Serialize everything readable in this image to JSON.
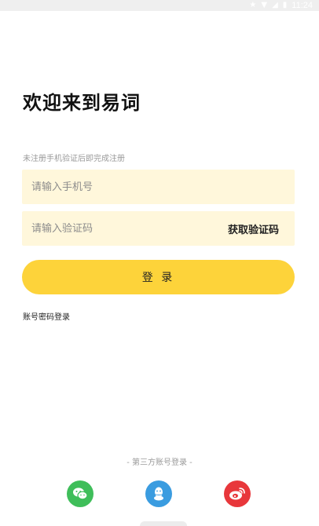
{
  "status_bar": {
    "time": "11:24",
    "icons": [
      "star-icon",
      "wifi-icon",
      "signal-icon",
      "battery-icon"
    ]
  },
  "title": "欢迎来到易词",
  "hint": "未注册手机验证后即完成注册",
  "phone_field": {
    "placeholder": "请输入手机号",
    "value": ""
  },
  "code_field": {
    "placeholder": "请输入验证码",
    "value": "",
    "get_code_label": "获取验证码"
  },
  "login_button": "登 录",
  "password_login": "账号密码登录",
  "third_party": {
    "title": "- 第三方账号登录 -",
    "providers": [
      {
        "name": "wechat",
        "icon": "wechat-icon",
        "color": "#3fbe5a"
      },
      {
        "name": "qq",
        "icon": "qq-icon",
        "color": "#3a9ce0"
      },
      {
        "name": "weibo",
        "icon": "weibo-icon",
        "color": "#e8373b"
      }
    ]
  },
  "colors": {
    "accent": "#fdd33a",
    "field_background": "#fff7db"
  }
}
